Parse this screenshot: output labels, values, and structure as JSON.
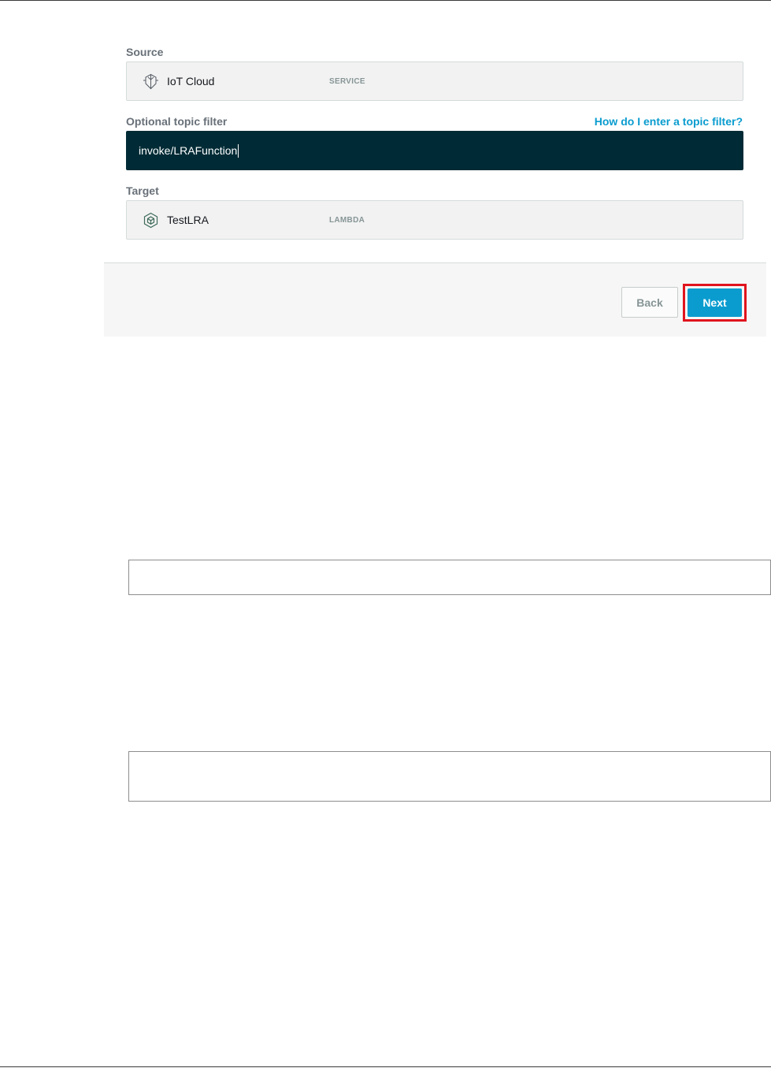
{
  "form": {
    "source_label": "Source",
    "topic_label": "Optional topic filter",
    "topic_help_link": "How do I enter a topic filter?",
    "target_label": "Target",
    "source": {
      "name": "IoT Cloud",
      "kind": "SERVICE",
      "icon": "iot-cloud-icon"
    },
    "topic_value": "invoke/LRAFunction",
    "target": {
      "name": "TestLRA",
      "kind": "LAMBDA",
      "icon": "lambda-function-icon"
    }
  },
  "footer": {
    "back_label": "Back",
    "next_label": "Next"
  },
  "colors": {
    "accent": "#0a9ccf",
    "input_background": "#002b36",
    "highlight": "#e0141e"
  }
}
